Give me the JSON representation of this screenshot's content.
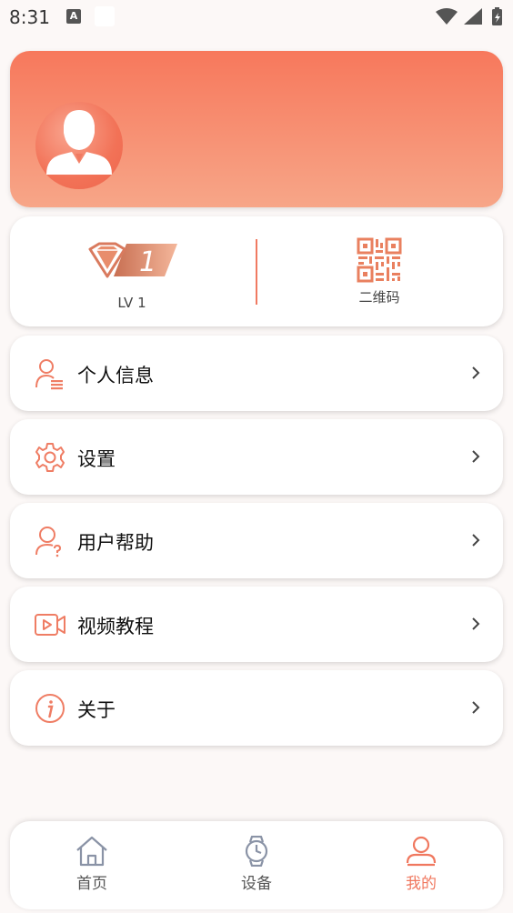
{
  "status_bar": {
    "time": "8:31",
    "notification_letter": "A"
  },
  "level": {
    "label": "LV 1",
    "badge_number": "1"
  },
  "qr": {
    "label": "二维码"
  },
  "menu": {
    "items": [
      {
        "label": "个人信息",
        "icon": "user-info-icon"
      },
      {
        "label": "设置",
        "icon": "gear-icon"
      },
      {
        "label": "用户帮助",
        "icon": "user-help-icon"
      },
      {
        "label": "视频教程",
        "icon": "video-icon"
      },
      {
        "label": "关于",
        "icon": "info-icon"
      }
    ]
  },
  "bottom_nav": {
    "items": [
      {
        "label": "首页",
        "icon": "home-icon",
        "active": false
      },
      {
        "label": "设备",
        "icon": "watch-icon",
        "active": false
      },
      {
        "label": "我的",
        "icon": "person-icon",
        "active": true
      }
    ]
  },
  "colors": {
    "accent": "#f0785f",
    "header_top": "#f7785c",
    "header_bottom": "#f7a688"
  }
}
